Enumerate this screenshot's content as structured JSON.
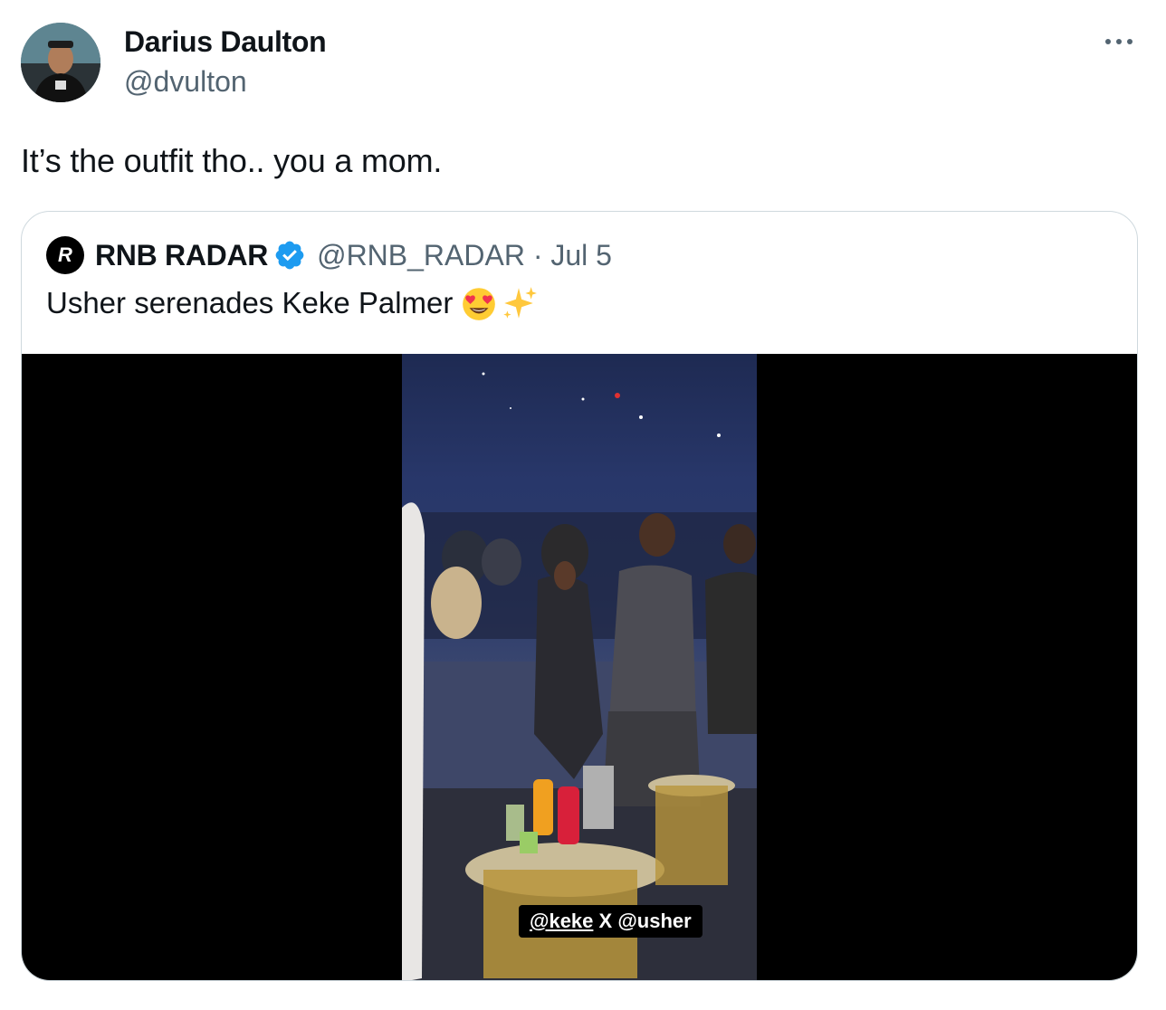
{
  "author": {
    "name": "Darius Daulton",
    "handle": "@dvulton",
    "avatar_icon": "profile-photo"
  },
  "more_icon": "more-dots-icon",
  "tweet_text": "It’s the outfit tho.. you a mom.",
  "quoted": {
    "avatar_letter": "R",
    "name": "RNB RADAR",
    "verified_icon": "verified-badge-icon",
    "verified_color": "#1d9bf0",
    "handle_date": "@RNB_RADAR · Jul 5",
    "text": "Usher serenades Keke Palmer",
    "emojis": [
      "heart-eyes-emoji",
      "sparkles-emoji"
    ],
    "video": {
      "caption_tag1": "@keke",
      "caption_mid": " X ",
      "caption_tag2": "@usher"
    }
  }
}
